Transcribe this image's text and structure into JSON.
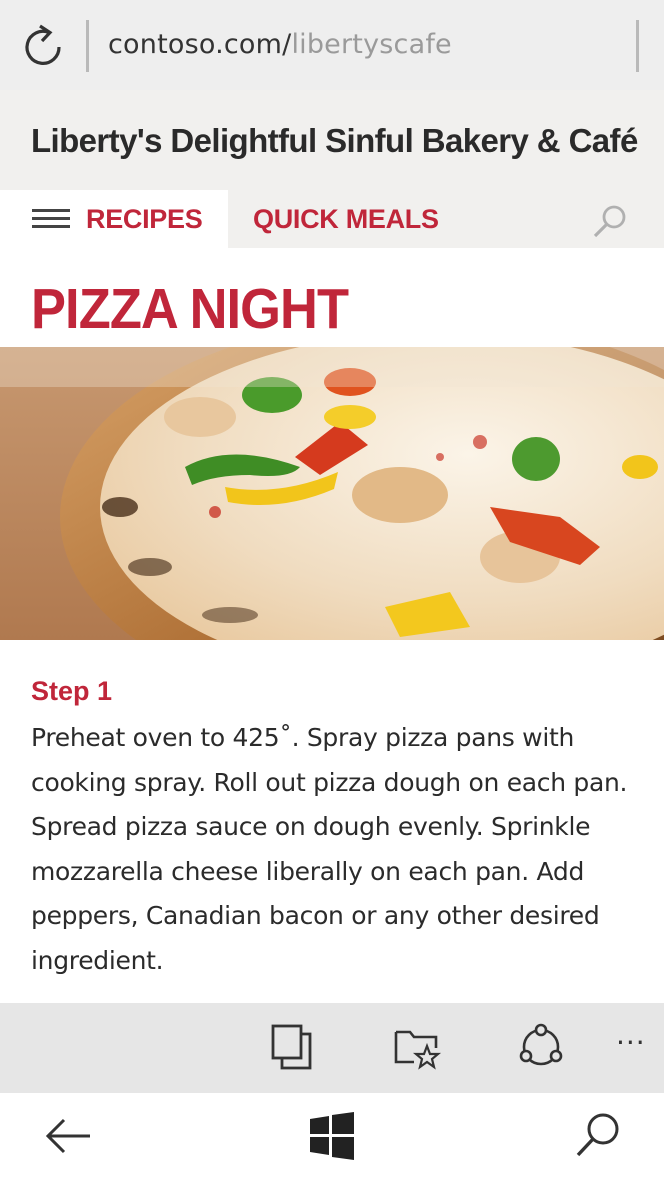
{
  "browser": {
    "url_domain": "contoso.com/",
    "url_path": "libertyscafe",
    "refresh_icon": "refresh-icon"
  },
  "site": {
    "title": "Liberty's Delightful Sinful Bakery & Café",
    "nav": {
      "menu_icon": "hamburger-menu-icon",
      "items": [
        {
          "label": "RECIPES",
          "active": true
        },
        {
          "label": "QUICK MEALS",
          "active": false
        }
      ],
      "search_icon": "search-icon"
    },
    "accent_color": "#c0263a"
  },
  "page": {
    "title": "PIZZA NIGHT",
    "hero_image": "pizza-photo",
    "step": {
      "title": "Step 1",
      "text": "Preheat oven to 425˚. Spray pizza pans with cooking spray. Roll out pizza dough on each pan. Spread pizza sauce on dough evenly. Sprinkle mozzarella cheese liberally on each pan. Add peppers, Canadian bacon or any other desired ingredient."
    }
  },
  "toolbar": {
    "icons": [
      "tabs-icon",
      "favorites-icon",
      "share-icon"
    ],
    "more": "···"
  },
  "system_nav": {
    "icons": [
      "back-arrow-icon",
      "windows-logo-icon",
      "search-icon"
    ]
  }
}
